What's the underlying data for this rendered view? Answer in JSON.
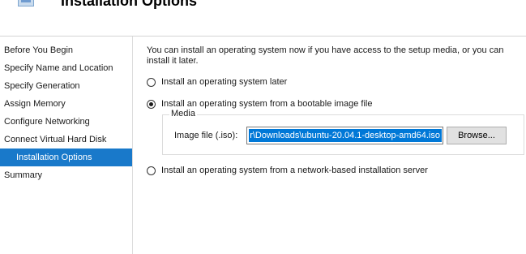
{
  "header": {
    "title": "Installation Options"
  },
  "sidebar": {
    "items": [
      {
        "label": "Before You Begin"
      },
      {
        "label": "Specify Name and Location"
      },
      {
        "label": "Specify Generation"
      },
      {
        "label": "Assign Memory"
      },
      {
        "label": "Configure Networking"
      },
      {
        "label": "Connect Virtual Hard Disk"
      },
      {
        "label": "Installation Options"
      },
      {
        "label": "Summary"
      }
    ],
    "active_index": 6,
    "active_color": "#1979ca"
  },
  "main": {
    "intro": "You can install an operating system now if you have access to the setup media, or you can install it later.",
    "options": [
      {
        "label": "Install an operating system later",
        "selected": false
      },
      {
        "label": "Install an operating system from a bootable image file",
        "selected": true
      },
      {
        "label": "Install an operating system from a network-based installation server",
        "selected": false
      }
    ],
    "media": {
      "group_label": "Media",
      "image_file_label": "Image file (.iso):",
      "image_file_value": "r\\Downloads\\ubuntu-20.04.1-desktop-amd64.iso",
      "browse_label": "Browse..."
    }
  }
}
